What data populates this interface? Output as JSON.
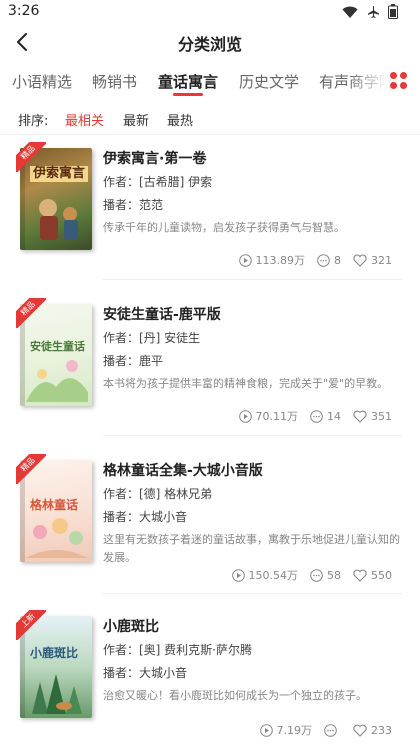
{
  "status": {
    "time": "3:26",
    "icons": [
      "wifi-icon",
      "airplane-icon",
      "battery-icon"
    ]
  },
  "nav": {
    "title": "分类浏览",
    "back_icon": "back-arrow-icon"
  },
  "tabs": [
    {
      "label": "小语精选",
      "active": false
    },
    {
      "label": "畅销书",
      "active": false
    },
    {
      "label": "童话寓言",
      "active": true
    },
    {
      "label": "历史文学",
      "active": false
    },
    {
      "label": "有声商学院",
      "active": false
    }
  ],
  "more_icon": "grid-menu-icon",
  "sort": {
    "label": "排序:",
    "options": [
      {
        "label": "最相关",
        "active": true
      },
      {
        "label": "最新",
        "active": false
      },
      {
        "label": "最热",
        "active": false
      }
    ]
  },
  "colors": {
    "accent": "#e53935",
    "text": "#222222",
    "muted": "#888888"
  },
  "books": [
    {
      "badge": "精品",
      "cover_text": "伊索寓言",
      "title": "伊索寓言·第一卷",
      "author": "作者：[古希腊] 伊索",
      "narrator": "播者：范范",
      "desc": "传承千年的儿童读物，启发孩子获得勇气与智慧。",
      "plays": "113.89万",
      "comments": "8",
      "likes": "321"
    },
    {
      "badge": "精品",
      "cover_text": "安徒生童话",
      "title": "安徒生童话-鹿平版",
      "author": "作者：[丹] 安徒生",
      "narrator": "播者：鹿平",
      "desc": "本书将为孩子提供丰富的精神食粮，完成关于\"爱\"的早教。",
      "plays": "70.11万",
      "comments": "14",
      "likes": "351"
    },
    {
      "badge": "精品",
      "cover_text": "格林童话",
      "title": "格林童话全集-大城小音版",
      "author": "作者：[德] 格林兄弟",
      "narrator": "播者：大城小音",
      "desc": "这里有无数孩子着迷的童话故事，寓教于乐地促进儿童认知的发展。",
      "plays": "150.54万",
      "comments": "58",
      "likes": "550"
    },
    {
      "badge": "上新",
      "cover_text": "小鹿斑比",
      "title": "小鹿斑比",
      "author": "作者：[奥] 费利克斯·萨尔腾",
      "narrator": "播者：大城小音",
      "desc": "治愈又暖心！看小鹿斑比如何成长为一个独立的孩子。",
      "plays": "7.19万",
      "comments": "",
      "likes": "233"
    }
  ]
}
